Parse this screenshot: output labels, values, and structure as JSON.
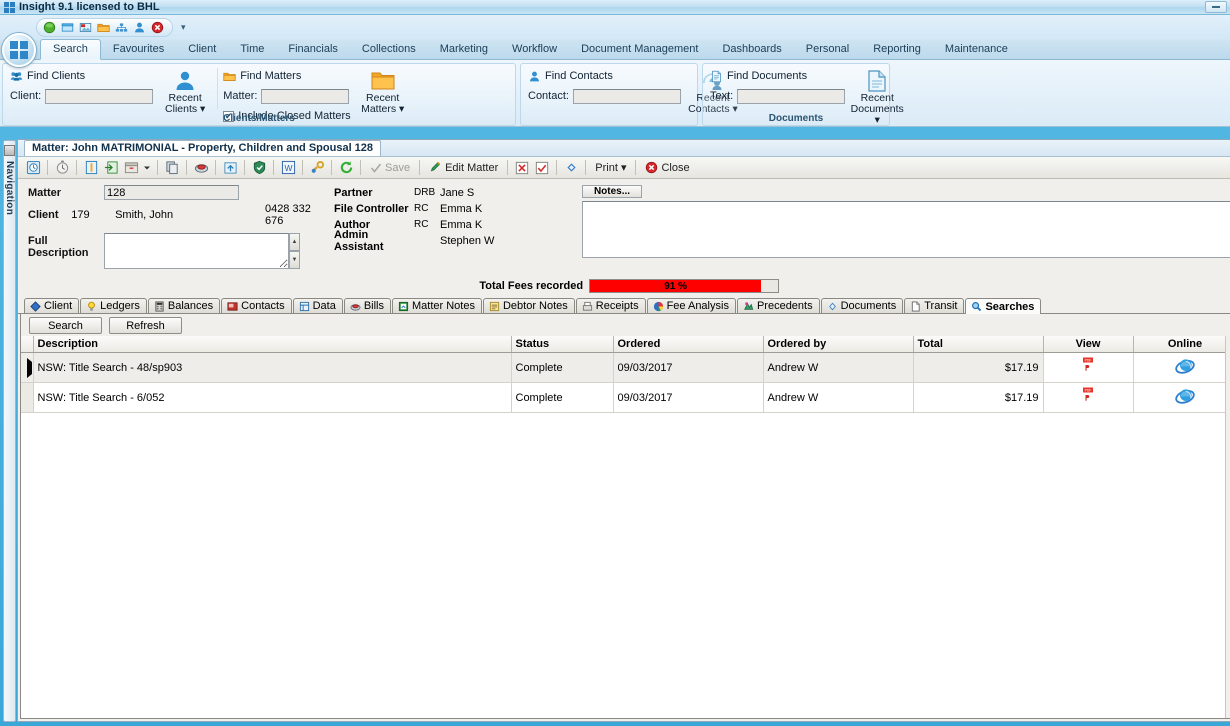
{
  "window": {
    "title": "Insight 9.1 licensed to BHL",
    "minimize_label": "—"
  },
  "quick_access": {
    "icons": [
      "green-circle-icon",
      "window-icon",
      "picture-icon",
      "folder-icon",
      "network-icon",
      "person-icon",
      "delete-icon"
    ],
    "dropdown_label": "▾"
  },
  "ribbon": {
    "tabs": [
      {
        "label": "Search",
        "active": true
      },
      {
        "label": "Favourites",
        "active": false
      },
      {
        "label": "Client",
        "active": false
      },
      {
        "label": "Time",
        "active": false
      },
      {
        "label": "Financials",
        "active": false
      },
      {
        "label": "Collections",
        "active": false
      },
      {
        "label": "Marketing",
        "active": false
      },
      {
        "label": "Workflow",
        "active": false
      },
      {
        "label": "Document Management",
        "active": false
      },
      {
        "label": "Dashboards",
        "active": false
      },
      {
        "label": "Personal",
        "active": false
      },
      {
        "label": "Reporting",
        "active": false
      },
      {
        "label": "Maintenance",
        "active": false
      }
    ],
    "groups": [
      {
        "name": "Clients/Matters",
        "label": "Clients/Matters",
        "panels": [
          {
            "heading": "Find Clients",
            "heading_icon": "clients-icon",
            "field_label": "Client:",
            "field_value": "",
            "button_line1": "Recent",
            "button_line2": "Clients ▾",
            "button_icon": "person-blue-icon"
          },
          {
            "heading": "Find Matters",
            "heading_icon": "folder-orange-icon",
            "field_label": "Matter:",
            "field_value": "",
            "checkbox_label": "Include Closed Matters",
            "checkbox_checked": true,
            "button_line1": "Recent",
            "button_line2": "Matters ▾",
            "button_icon": "folder-orange-icon"
          }
        ]
      },
      {
        "name": "Contacts",
        "label": "",
        "panels": [
          {
            "heading": "Find Contacts",
            "heading_icon": "contact-icon",
            "field_label": "Contact:",
            "field_value": "",
            "button_line1": "Recent",
            "button_line2": "Contacts ▾",
            "button_icon": "contacts-icon"
          }
        ]
      },
      {
        "name": "Documents",
        "label": "Documents",
        "panels": [
          {
            "heading": "Find Documents",
            "heading_icon": "document-icon",
            "field_label": "Text:",
            "field_value": "",
            "button_line1": "Recent",
            "button_line2": "Documents ▾",
            "button_icon": "document-icon"
          }
        ]
      }
    ]
  },
  "navigation": {
    "label": "Navigation",
    "icon": "navigation-icon"
  },
  "document_tab": {
    "label": "Matter:  John MATRIMONIAL - Property, Children and Spousal 128"
  },
  "matter_toolbar": {
    "icons": [
      "history-icon",
      "timer-icon",
      "note-icon",
      "export-icon",
      "archive-icon",
      "copy-icon",
      "envelope-icon",
      "open-folder-icon",
      "shield-icon",
      "word-icon",
      "link-icon",
      "refresh-icon"
    ],
    "save_label": "Save",
    "edit_matter_label": "Edit Matter",
    "print_label": "Print ▾",
    "close_label": "Close"
  },
  "matter": {
    "matter_label": "Matter",
    "matter_number": "128",
    "client_label": "Client",
    "client_number": "179",
    "client_name": "Smith, John",
    "client_phone": "0428 332 676",
    "full_description_label": "Full Description",
    "full_description_value": "",
    "staff": [
      {
        "role": "Partner",
        "code": "DRB",
        "name": "Jane S"
      },
      {
        "role": "File Controller",
        "code": "RC",
        "name": "Emma K"
      },
      {
        "role": "Author",
        "code": "RC",
        "name": "Emma K"
      },
      {
        "role": "Admin Assistant",
        "code": "",
        "name": "Stephen W"
      }
    ],
    "notes_button_label": "Notes...",
    "notes_value": "",
    "fees_label": "Total Fees  recorded",
    "fees_percent_label": "91 %",
    "fees_percent_value": 91,
    "fees_color": "#fe0000"
  },
  "lower_tabs": [
    {
      "label": "Client",
      "icon": "diamond-blue-icon",
      "active": false
    },
    {
      "label": "Ledgers",
      "icon": "bulb-icon",
      "active": false
    },
    {
      "label": "Balances",
      "icon": "calculator-icon",
      "active": false
    },
    {
      "label": "Contacts",
      "icon": "contacts-red-icon",
      "active": false
    },
    {
      "label": "Data",
      "icon": "data-icon",
      "active": false
    },
    {
      "label": "Bills",
      "icon": "bills-icon",
      "active": false
    },
    {
      "label": "Matter Notes",
      "icon": "matter-notes-icon",
      "active": false
    },
    {
      "label": "Debtor Notes",
      "icon": "debtor-notes-icon",
      "active": false
    },
    {
      "label": "Receipts",
      "icon": "receipts-icon",
      "active": false
    },
    {
      "label": "Fee Analysis",
      "icon": "pie-chart-icon",
      "active": false
    },
    {
      "label": "Precedents",
      "icon": "precedents-icon",
      "active": false
    },
    {
      "label": "Documents",
      "icon": "documents-icon",
      "active": false
    },
    {
      "label": "Transit",
      "icon": "transit-icon",
      "active": false
    },
    {
      "label": "Searches",
      "icon": "search-magnifier-icon",
      "active": true
    }
  ],
  "searches_panel": {
    "search_button_label": "Search",
    "refresh_button_label": "Refresh",
    "columns": [
      {
        "label": "Description",
        "align": "left"
      },
      {
        "label": "Status",
        "align": "left"
      },
      {
        "label": "Ordered",
        "align": "left"
      },
      {
        "label": "Ordered by",
        "align": "left"
      },
      {
        "label": "Total",
        "align": "left"
      },
      {
        "label": "View",
        "align": "center"
      },
      {
        "label": "Online",
        "align": "center"
      }
    ],
    "rows": [
      {
        "selected": true,
        "description": "NSW: Title Search - 48/sp903",
        "status": "Complete",
        "ordered": "09/03/2017",
        "ordered_by": "Andrew W",
        "total": "$17.19",
        "view_icon": "pdf-icon",
        "online_icon": "internet-explorer-icon"
      },
      {
        "selected": false,
        "description": "NSW: Title Search - 6/052",
        "status": "Complete",
        "ordered": "09/03/2017",
        "ordered_by": "Andrew W",
        "total": "$17.19",
        "view_icon": "pdf-icon",
        "online_icon": "internet-explorer-icon"
      }
    ]
  }
}
